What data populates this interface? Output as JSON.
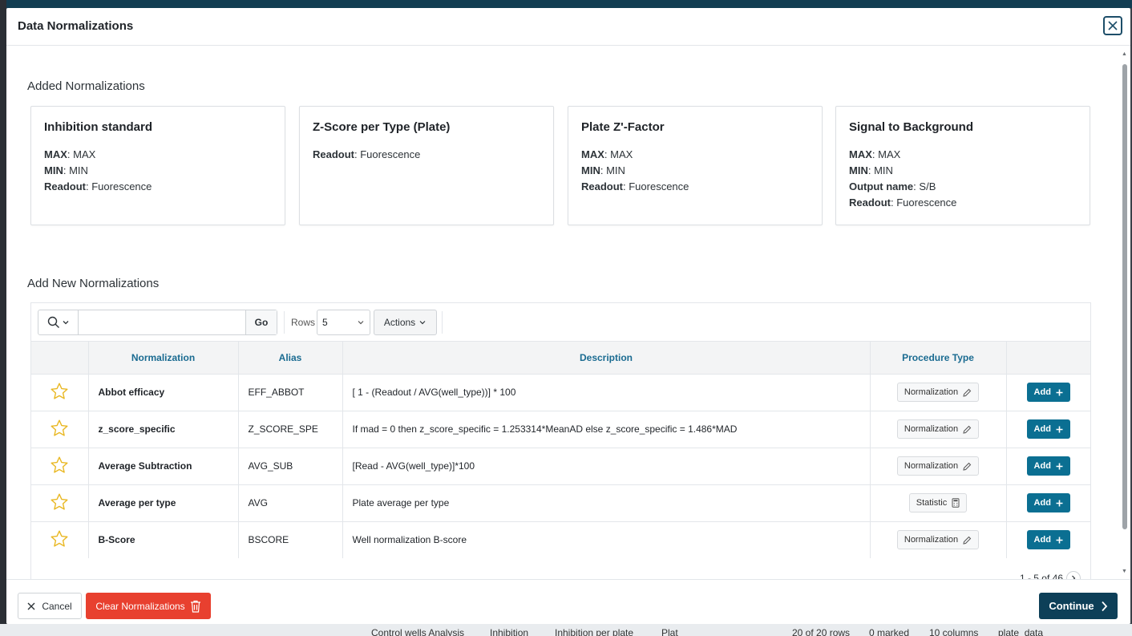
{
  "modal": {
    "title": "Data Normalizations"
  },
  "added": {
    "section_title": "Added Normalizations",
    "cards": [
      {
        "title": "Inhibition standard",
        "lines": [
          {
            "key": "MAX",
            "value": "MAX"
          },
          {
            "key": "MIN",
            "value": "MIN"
          },
          {
            "key": "Readout",
            "value": "Fuorescence"
          }
        ]
      },
      {
        "title": "Z-Score per Type (Plate)",
        "lines": [
          {
            "key": "Readout",
            "value": "Fuorescence"
          }
        ]
      },
      {
        "title": "Plate Z'-Factor",
        "lines": [
          {
            "key": "MAX",
            "value": "MAX"
          },
          {
            "key": "MIN",
            "value": "MIN"
          },
          {
            "key": "Readout",
            "value": "Fuorescence"
          }
        ]
      },
      {
        "title": "Signal to Background",
        "lines": [
          {
            "key": "MAX",
            "value": "MAX"
          },
          {
            "key": "MIN",
            "value": "MIN"
          },
          {
            "key": "Output name",
            "value": "S/B"
          },
          {
            "key": "Readout",
            "value": "Fuorescence"
          }
        ]
      }
    ]
  },
  "add_new": {
    "section_title": "Add New Normalizations",
    "toolbar": {
      "search_value": "",
      "go_label": "Go",
      "rows_label": "Rows",
      "rows_value": "5",
      "actions_label": "Actions"
    },
    "columns": [
      "",
      "Normalization",
      "Alias",
      "Description",
      "Procedure Type",
      ""
    ],
    "rows": [
      {
        "name": "Abbot efficacy",
        "alias": "EFF_ABBOT",
        "description": "[ 1 - (Readout / AVG(well_type))] * 100",
        "type": "Normalization",
        "type_icon": "pencil-icon",
        "add_label": "Add"
      },
      {
        "name": "z_score_specific",
        "alias": "Z_SCORE_SPE",
        "description": "If mad = 0 then z_score_specific = 1.253314*MeanAD else z_score_specific = 1.486*MAD",
        "type": "Normalization",
        "type_icon": "pencil-icon",
        "add_label": "Add"
      },
      {
        "name": "Average Subtraction",
        "alias": "AVG_SUB",
        "description": "[Read - AVG(well_type)]*100",
        "type": "Normalization",
        "type_icon": "pencil-icon",
        "add_label": "Add"
      },
      {
        "name": "Average per type",
        "alias": "AVG",
        "description": "Plate average per type",
        "type": "Statistic",
        "type_icon": "calculator-icon",
        "add_label": "Add"
      },
      {
        "name": "B-Score",
        "alias": "BSCORE",
        "description": "Well normalization B-score",
        "type": "Normalization",
        "type_icon": "pencil-icon",
        "add_label": "Add"
      }
    ],
    "pagination": "1 - 5 of 46"
  },
  "footer": {
    "cancel_label": "Cancel",
    "clear_label": "Clear Normalizations",
    "continue_label": "Continue"
  },
  "background": {
    "bottom_items": [
      "Control wells Analysis",
      "Inhibition",
      "Inhibition per plate",
      "Plat",
      "20 of 20 rows",
      "0 marked",
      "10 columns",
      "plate_data"
    ]
  },
  "colors": {
    "accent": "#0b6f92",
    "header_text": "#1a6b91",
    "danger": "#e8402f",
    "primary": "#0d3f58",
    "star": "#e9b824"
  }
}
